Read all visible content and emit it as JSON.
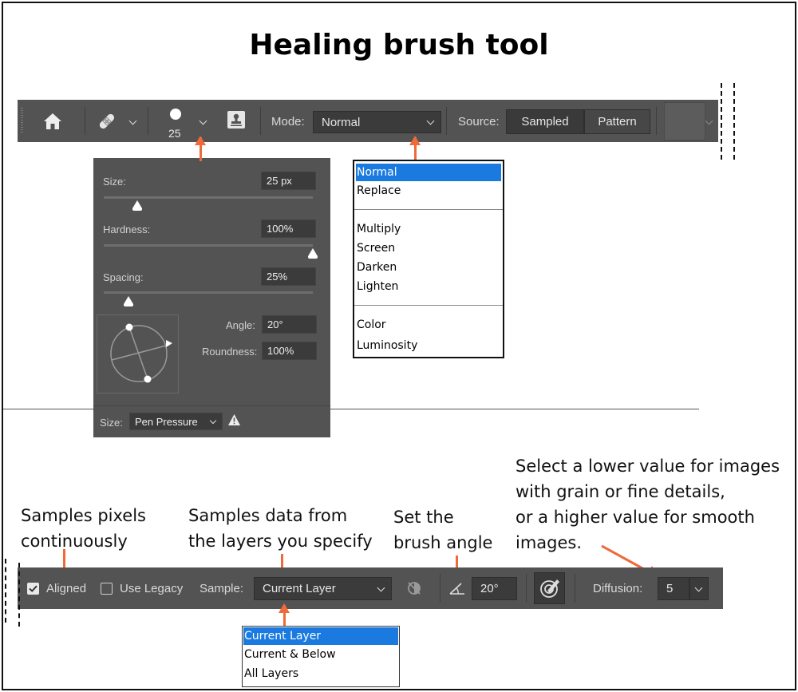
{
  "title": "Healing brush tool",
  "colors": {
    "toolbar_bg": "#535353",
    "field_bg": "#3b3b3b",
    "accent": "#ee6a3a",
    "menu_selected": "#1a7ae0"
  },
  "toolbar": {
    "brush_size": "25",
    "mode_label": "Mode:",
    "mode_value": "Normal",
    "source_label": "Source:",
    "source_sampled": "Sampled",
    "source_pattern": "Pattern",
    "icons": [
      "home-icon",
      "bandage-icon",
      "brush-tip-icon",
      "stamp-icon"
    ]
  },
  "brush_panel": {
    "size_label": "Size:",
    "size_value": "25 px",
    "size_level": 0.16,
    "hardness_label": "Hardness:",
    "hardness_value": "100%",
    "hardness_level": 1.0,
    "spacing_label": "Spacing:",
    "spacing_value": "25%",
    "spacing_level": 0.12,
    "angle_label": "Angle:",
    "angle_value": "20°",
    "roundness_label": "Roundness:",
    "roundness_value": "100%",
    "pressure_label": "Size:",
    "pressure_value": "Pen Pressure"
  },
  "mode_menu": {
    "items": [
      "Normal",
      "Replace",
      "Multiply",
      "Screen",
      "Darken",
      "Lighten",
      "Color",
      "Luminosity"
    ],
    "selected": "Normal"
  },
  "toolbar2": {
    "aligned_label": "Aligned",
    "aligned_checked": true,
    "legacy_label": "Use Legacy",
    "legacy_checked": false,
    "sample_label": "Sample:",
    "sample_value": "Current Layer",
    "angle_value": "20°",
    "diffusion_label": "Diffusion:",
    "diffusion_value": "5"
  },
  "sample_menu": {
    "items": [
      "Current Layer",
      "Current & Below",
      "All Layers"
    ],
    "selected": "Current Layer"
  },
  "notes": {
    "aligned_1": "Samples pixels",
    "aligned_2": "continuously",
    "sample_1": "Samples data from",
    "sample_2": "the layers you specify",
    "angle_1": "Set the",
    "angle_2": "brush angle",
    "diffusion_1": "Select a lower value for images",
    "diffusion_2": "with grain or fine details,",
    "diffusion_3": "or a higher value for smooth",
    "diffusion_4": "images."
  }
}
